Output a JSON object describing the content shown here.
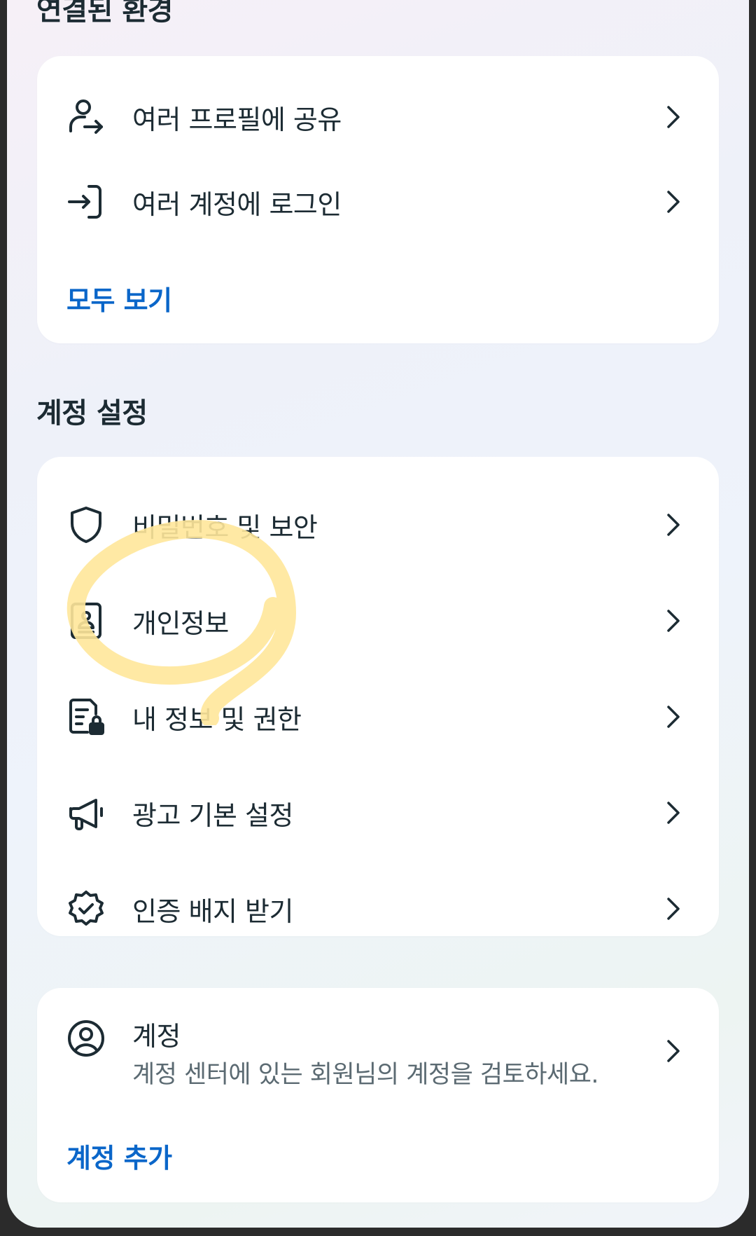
{
  "sections": {
    "connected": {
      "title": "연결된 환경",
      "items": [
        {
          "label": "여러 프로필에 공유",
          "icon": "profile-share-icon"
        },
        {
          "label": "여러 계정에 로그인",
          "icon": "login-arrow-icon"
        }
      ],
      "see_all": "모두 보기"
    },
    "account_settings": {
      "title": "계정 설정",
      "items": [
        {
          "label": "비밀번호 및 보안",
          "icon": "shield-icon"
        },
        {
          "label": "개인정보",
          "icon": "id-card-icon"
        },
        {
          "label": "내 정보 및 권한",
          "icon": "document-lock-icon"
        },
        {
          "label": "광고 기본 설정",
          "icon": "megaphone-icon"
        },
        {
          "label": "인증 배지 받기",
          "icon": "verified-badge-icon"
        }
      ]
    },
    "accounts": {
      "title": "계정",
      "subtitle": "계정 센터에 있는 회원님의 계정을 검토하세요.",
      "icon": "account-circle-icon",
      "add_account": "계정 추가"
    }
  },
  "colors": {
    "text": "#1c2b33",
    "subtext": "#5b6a72",
    "link": "#0a66c9",
    "highlight": "#ffe79a"
  }
}
